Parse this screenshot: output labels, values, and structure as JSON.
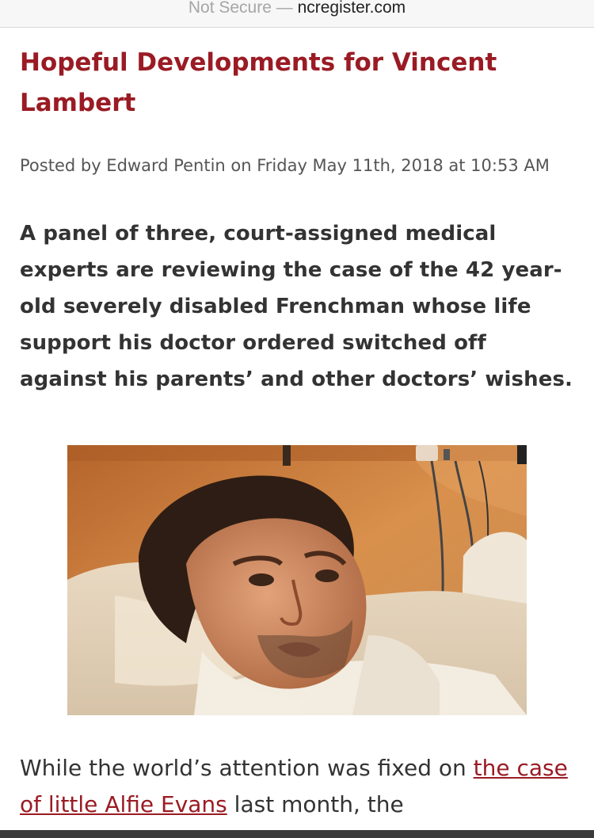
{
  "browser": {
    "security_label": "Not Secure",
    "separator": " — ",
    "domain": "ncregister.com"
  },
  "article": {
    "title": "Hopeful Developments for Vincent Lambert",
    "byline": "Posted by Edward Pentin on Friday May 11th, 2018 at 10:53 AM",
    "lead": "A panel of three, court-assigned medical experts are reviewing the case of the 42 year-old severely disabled Frenchman whose life support his doctor ordered switched off against his parents’ and other doctors’ wishes.",
    "body_before_link": "While the world’s attention was fixed on ",
    "body_link": "the case of little Alfie Evans",
    "body_after_link": " last month, the"
  }
}
